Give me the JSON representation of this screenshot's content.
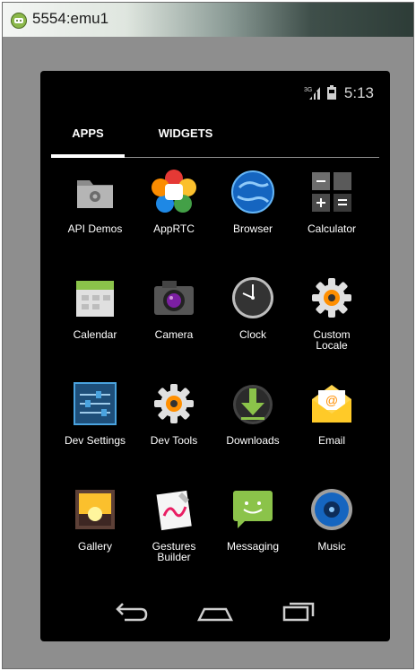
{
  "window": {
    "title": "5554:emu1",
    "icon": "android-icon"
  },
  "status_bar": {
    "time": "5:13",
    "network_label": "3G",
    "icons": [
      "signal-icon",
      "battery-icon"
    ]
  },
  "tabs": [
    {
      "label": "APPS",
      "selected": true
    },
    {
      "label": "WIDGETS",
      "selected": false
    }
  ],
  "apps": [
    {
      "label": "API Demos",
      "icon": "folder-gear-icon"
    },
    {
      "label": "AppRTC",
      "icon": "webrtc-icon"
    },
    {
      "label": "Browser",
      "icon": "globe-icon"
    },
    {
      "label": "Calculator",
      "icon": "calculator-icon"
    },
    {
      "label": "Calendar",
      "icon": "calendar-icon"
    },
    {
      "label": "Camera",
      "icon": "camera-icon"
    },
    {
      "label": "Clock",
      "icon": "clock-icon"
    },
    {
      "label": "Custom\nLocale",
      "icon": "gear-icon"
    },
    {
      "label": "Dev Settings",
      "icon": "settings-sliders-icon"
    },
    {
      "label": "Dev Tools",
      "icon": "gear-icon"
    },
    {
      "label": "Downloads",
      "icon": "download-icon"
    },
    {
      "label": "Email",
      "icon": "email-icon"
    },
    {
      "label": "Gallery",
      "icon": "gallery-icon"
    },
    {
      "label": "Gestures\nBuilder",
      "icon": "gestures-icon"
    },
    {
      "label": "Messaging",
      "icon": "messaging-icon"
    },
    {
      "label": "Music",
      "icon": "speaker-icon"
    }
  ],
  "nav_bar": {
    "buttons": [
      "back-icon",
      "home-icon",
      "recent-apps-icon"
    ]
  },
  "colors": {
    "screen_bg": "#000000",
    "tab_indicator": "#ffffff",
    "frame_bg": "#8e8e8e"
  }
}
